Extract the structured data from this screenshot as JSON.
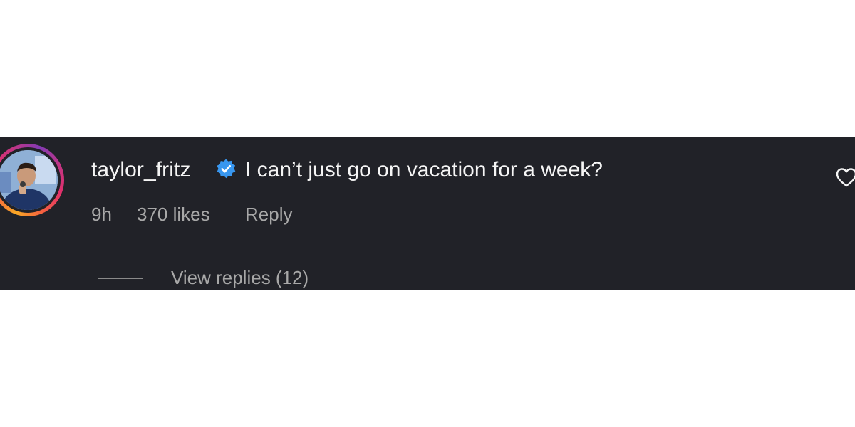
{
  "comment": {
    "username": "taylor_fritz",
    "verified": true,
    "text": "I can’t just go on vacation for a week?",
    "time": "9h",
    "likes": "370 likes",
    "reply_label": "Reply",
    "view_replies_label": "View replies (12)"
  },
  "icons": {
    "verified": "verified-badge-icon",
    "like": "heart-outline-icon"
  },
  "colors": {
    "panel_bg": "#212228",
    "text_primary": "#f5f5f5",
    "text_secondary": "#a8a8a8",
    "verified_blue": "#3897f0"
  }
}
